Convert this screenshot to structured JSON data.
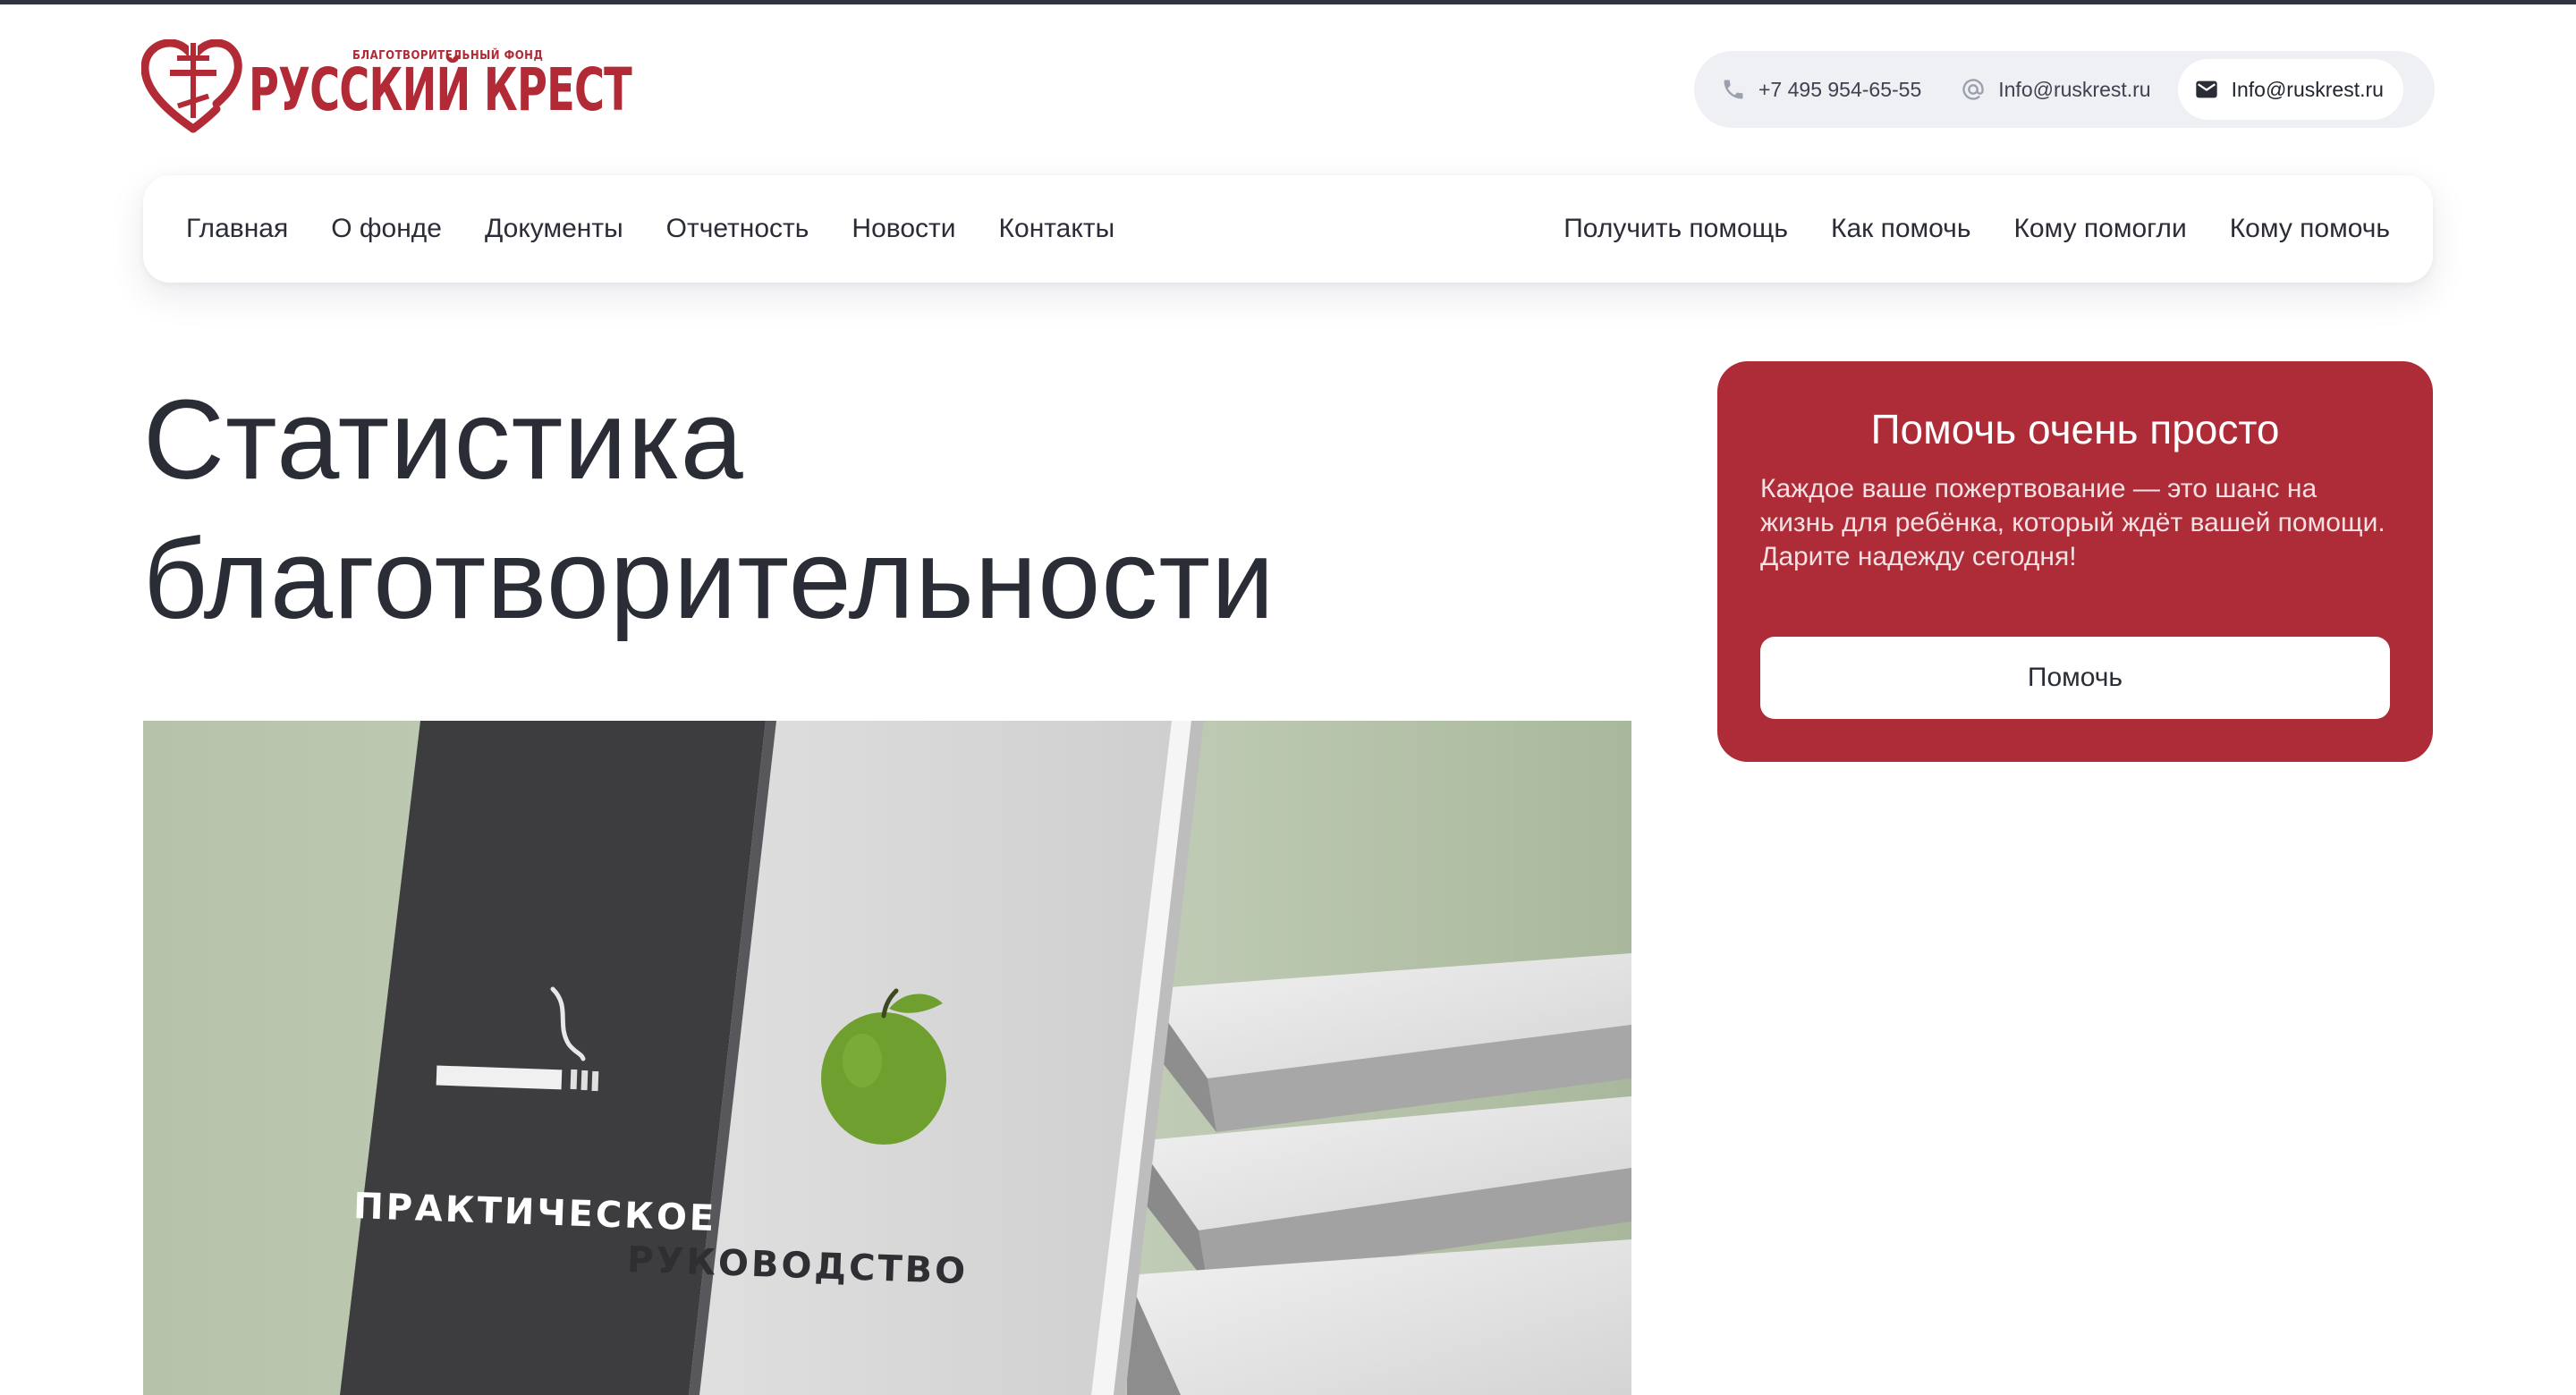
{
  "header": {
    "logo": {
      "tagline": "БЛАГОТВОРИТЕЛЬНЫЙ ФОНД",
      "name": "РУССКИЙ КРЕСТ",
      "brand_color": "#b12a35"
    },
    "contacts": {
      "phone": {
        "icon": "phone-icon",
        "text": "+7 495 954-65-55"
      },
      "email": {
        "icon": "at-icon",
        "text": "Info@ruskrest.ru"
      },
      "email_button": {
        "icon": "envelope-icon",
        "text": "Info@ruskrest.ru"
      }
    }
  },
  "nav": {
    "left": [
      "Главная",
      "О фонде",
      "Документы",
      "Отчетность",
      "Новости",
      "Контакты"
    ],
    "right": [
      "Получить помощь",
      "Как помочь",
      "Кому помогли",
      "Кому помочь"
    ]
  },
  "main": {
    "title": "Статистика благотворительности",
    "image": {
      "cover_text_line1": "ПРАКТИЧЕСКОЕ",
      "cover_text_line2": "РУКОВОДСТВО"
    }
  },
  "donate": {
    "title": "Помочь очень просто",
    "text": "Каждое ваше пожертвование — это шанс на жизнь для ребёнка, который ждёт вашей помощи. Дарите надежду сегодня!",
    "button": "Помочь",
    "accent_color": "#ad2c38"
  }
}
